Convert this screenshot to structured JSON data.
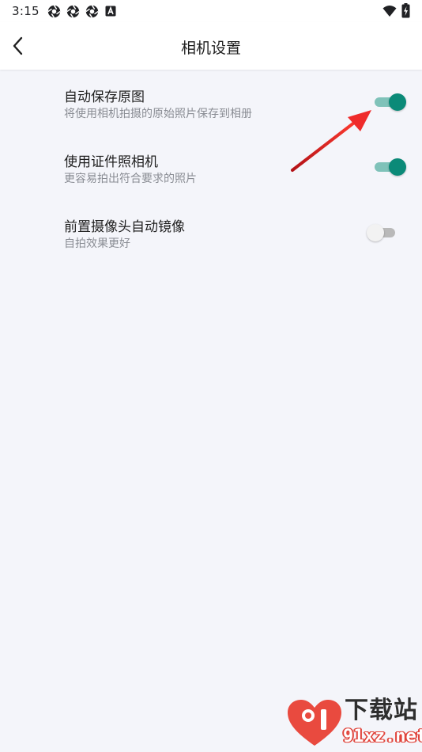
{
  "status_bar": {
    "time": "3:15",
    "notification_icons": [
      "shutter-icon",
      "shutter-icon",
      "shutter-icon",
      "a-badge-icon"
    ],
    "right_icons": [
      "wifi-icon",
      "battery-charging-icon"
    ]
  },
  "app_bar": {
    "back_icon": "chevron-left-icon",
    "title": "相机设置"
  },
  "settings": [
    {
      "title": "自动保存原图",
      "subtitle": "将使用相机拍摄的原始照片保存到相册",
      "enabled": true
    },
    {
      "title": "使用证件照相机",
      "subtitle": "更容易拍出符合要求的照片",
      "enabled": true
    },
    {
      "title": "前置摄像头自动镜像",
      "subtitle": "自拍效果更好",
      "enabled": false
    }
  ],
  "colors": {
    "accent": "#0b8a78",
    "accent_track": "#7fc2b9",
    "background": "#f4f5fa",
    "annotation_arrow": "#d9252a"
  },
  "watermark": {
    "brand": "下载站",
    "domain": "91xz.net"
  }
}
